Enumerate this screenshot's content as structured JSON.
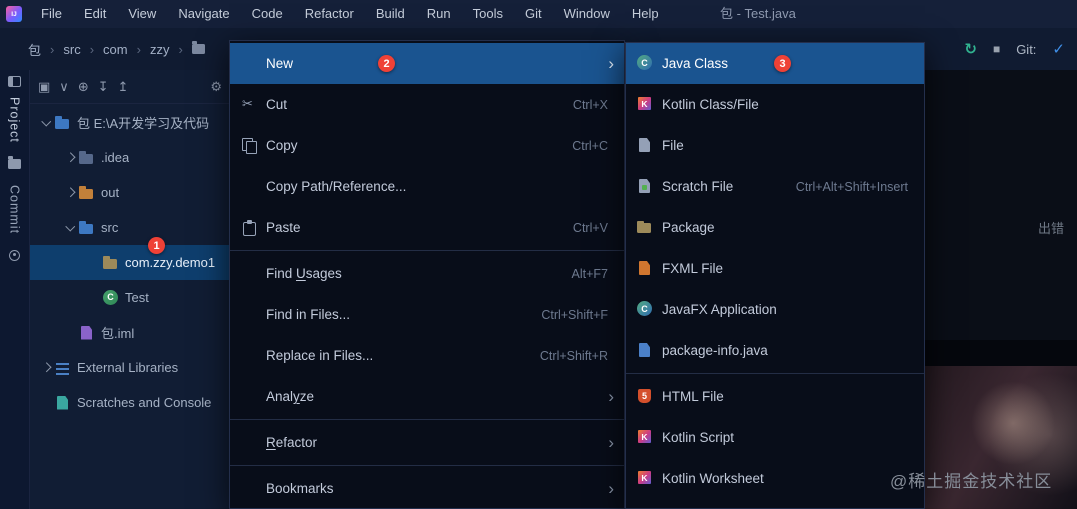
{
  "titlebar": {
    "menus": [
      "File",
      "Edit",
      "View",
      "Navigate",
      "Code",
      "Refactor",
      "Build",
      "Run",
      "Tools",
      "Git",
      "Window",
      "Help"
    ],
    "title": "包 - Test.java",
    "logo_text": "IJ"
  },
  "toolbar": {
    "breadcrumbs": [
      "包",
      "src",
      "com",
      "zzy"
    ],
    "git_label": "Git:"
  },
  "left_stripe": {
    "top_label": "Project",
    "bottom_label": "Commit"
  },
  "project_panel": {
    "toolbar_icons": [
      "panel",
      "chevron-down",
      "locate",
      "collapse-all",
      "expand-all",
      "settings"
    ]
  },
  "project_tree": {
    "items": [
      {
        "label": "包 E:\\A开发学习及代码",
        "level": 0,
        "chevron": "down",
        "icon": "project-folder"
      },
      {
        "label": ".idea",
        "level": 1,
        "chevron": "right",
        "icon": "folder"
      },
      {
        "label": "out",
        "level": 1,
        "chevron": "right",
        "icon": "folder-excluded"
      },
      {
        "label": "src",
        "level": 1,
        "chevron": "down",
        "icon": "folder-source"
      },
      {
        "label": "com.zzy.demo1",
        "level": 2,
        "icon": "package",
        "selected": true,
        "badge": "1"
      },
      {
        "label": "Test",
        "level": 2,
        "icon": "class"
      },
      {
        "label": "包.iml",
        "level": 1,
        "icon": "iml-file"
      },
      {
        "label": "External Libraries",
        "level": 0,
        "chevron": "right",
        "icon": "libraries"
      },
      {
        "label": "Scratches and Console",
        "level": 0,
        "icon": "scratches"
      }
    ]
  },
  "context_menu": {
    "items": [
      {
        "label": "New",
        "submenu": true,
        "selected": true,
        "badge": "2"
      },
      {
        "label": "Cut",
        "shortcut": "Ctrl+X",
        "icon": "scissors"
      },
      {
        "label": "Copy",
        "shortcut": "Ctrl+C",
        "icon": "copy"
      },
      {
        "label": "Copy Path/Reference..."
      },
      {
        "label": "Paste",
        "shortcut": "Ctrl+V",
        "icon": "paste"
      },
      {
        "separator": true
      },
      {
        "label": "Find Usages",
        "shortcut": "Alt+F7",
        "mnemonic": "U"
      },
      {
        "label": "Find in Files...",
        "shortcut": "Ctrl+Shift+F"
      },
      {
        "label": "Replace in Files...",
        "shortcut": "Ctrl+Shift+R"
      },
      {
        "label": "Analyze",
        "submenu": true,
        "mnemonic": "y"
      },
      {
        "separator": true
      },
      {
        "label": "Refactor",
        "submenu": true,
        "mnemonic": "R"
      },
      {
        "separator": true
      },
      {
        "label": "Bookmarks",
        "submenu": true
      }
    ]
  },
  "submenu": {
    "items": [
      {
        "label": "Java Class",
        "icon": "java-class",
        "selected": true,
        "badge": "3"
      },
      {
        "label": "Kotlin Class/File",
        "icon": "kotlin"
      },
      {
        "label": "File",
        "icon": "file"
      },
      {
        "label": "Scratch File",
        "icon": "scratch",
        "shortcut": "Ctrl+Alt+Shift+Insert"
      },
      {
        "label": "Package",
        "icon": "package"
      },
      {
        "label": "FXML File",
        "icon": "fxml"
      },
      {
        "label": "JavaFX Application",
        "icon": "javafx"
      },
      {
        "label": "package-info.java",
        "icon": "package-info"
      },
      {
        "separator": true
      },
      {
        "label": "HTML File",
        "icon": "html"
      },
      {
        "label": "Kotlin Script",
        "icon": "kotlin-script"
      },
      {
        "label": "Kotlin Worksheet",
        "icon": "kotlin-worksheet"
      }
    ]
  },
  "background": {
    "partial_text": "出错",
    "watermark": "@稀土掘金技术社区"
  },
  "icons": {
    "panel": "▣",
    "chevron-down": "∨",
    "locate": "⊕",
    "collapse-all": "↧",
    "expand-all": "↥",
    "settings": "⚙",
    "rerun": "↻",
    "stop": "■",
    "update": "✓"
  },
  "colors": {
    "selection_blue": "#1a5490",
    "tree_selection": "#0e3e6d",
    "badge_red": "#ef4136",
    "menu_bg": "#080d19",
    "titlebar_bg": "#152039"
  }
}
